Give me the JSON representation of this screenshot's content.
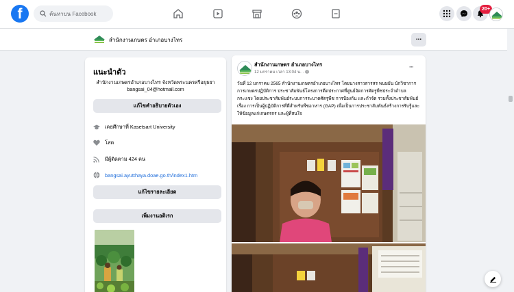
{
  "header": {
    "logo_letter": "f",
    "search_placeholder": "ค้นหาบน Facebook",
    "notification_count": "20+"
  },
  "page_strip": {
    "page_name": "สำนักงานเกษตร อำเภอบางไทร",
    "more_label": "..."
  },
  "intro": {
    "title": "แนะนำตัว",
    "bio_line1": "สำนักงานเกษตรอำเภอบางไทร จังหวัดพระนครศรีอยุธยา",
    "bio_line2": "bangsai_04@hotmail.com",
    "edit_bio_label": "แก้ไขคำอธิบายตัวเอง",
    "education": "เคยศึกษาที่ Kasetsart University",
    "relationship": "โสด",
    "followers": "มีผู้ติดตาม 424 คน",
    "website": "bangsai.ayutthaya.doae.go.th/index1.htm",
    "edit_details_label": "แก้ไขรายละเอียด",
    "add_hobbies_label": "เพิ่มงานอดิเรก"
  },
  "post": {
    "author": "สำนักงานเกษตร อำเภอบางไทร",
    "time": "12 มกราคม เวลา 13:04 น. · ",
    "more": "···",
    "body": "วันที่ 12 มกราคม  2565 สำนักงานเกษตรอำเภอบางไทร โดยนางสาวสารสร พนมยัน นักวิชาการการเกษตรปฏิบัติการ ประชาสัมพันธ์โครงการตีดประกาศที่ศูนย์จัดการศัตรูพืชประจำตำบลกระแชง โดยประชาสัมพันธ์ระบบการระบาดศัตรูพืช การป้องกัน และกำจัด รวมทั้งประชาสัมพันธ์เรื่อง การเป็นผู้ปฏิบัติการที่ดีสำหรับพืชอาหาร (GAP) เพื่อเป็นการประชาสัมพันธ์สร้างการรับรู้และให้ข้อมูลแก่เกษตรกร และผู้ที่สนใจ"
  },
  "colors": {
    "facebook_blue": "#1877f2",
    "link_blue": "#216fdb",
    "badge_red": "#e41e3f"
  }
}
